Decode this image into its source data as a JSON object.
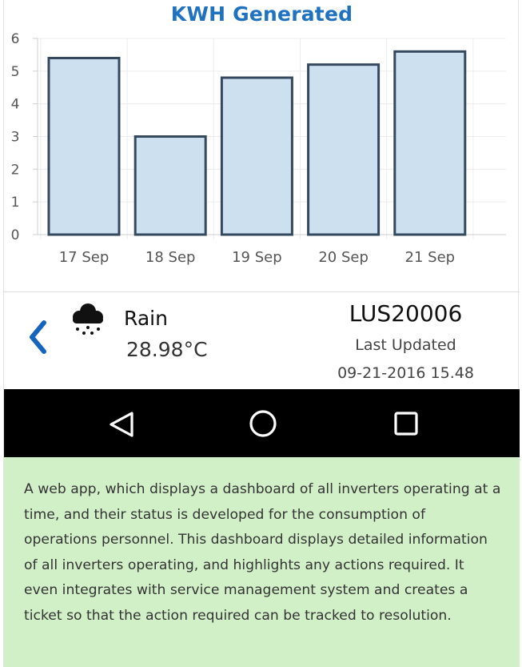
{
  "chart_data": {
    "type": "bar",
    "title": "KWH Generated",
    "categories": [
      "17 Sep",
      "18 Sep",
      "19 Sep",
      "20 Sep",
      "21 Sep"
    ],
    "values": [
      5.4,
      3.0,
      4.8,
      5.2,
      5.6
    ],
    "ylim": [
      0,
      6
    ],
    "yticks": [
      "0",
      "1",
      "2",
      "3",
      "4",
      "5",
      "6"
    ],
    "grid": true,
    "bar_fill": "#cde0f0",
    "bar_stroke": "#34495e"
  },
  "weather": {
    "back_icon": "chevron-left-icon",
    "condition_icon": "cloud-rain-icon",
    "condition": "Rain",
    "temperature": "28.98°C"
  },
  "device": {
    "id": "LUS20006",
    "last_updated_label": "Last Updated",
    "last_updated_time": "09-21-2016 15.48"
  },
  "navbar": {
    "back_icon": "triangle-back-icon",
    "home_icon": "circle-home-icon",
    "recents_icon": "square-recents-icon"
  },
  "description": "A web app, which displays a dashboard of all inverters operating at a time, and their status is developed for the consumption of operations personnel. This dashboard displays detailed information of all inverters operating, and highlights any actions required. It even integrates with service management system and creates a ticket so that the action required can be tracked to resolution.",
  "colors": {
    "title": "#1f72c0",
    "accent": "#1565c0",
    "navbar": "#000000",
    "description_bg": "#d2f0c8"
  }
}
